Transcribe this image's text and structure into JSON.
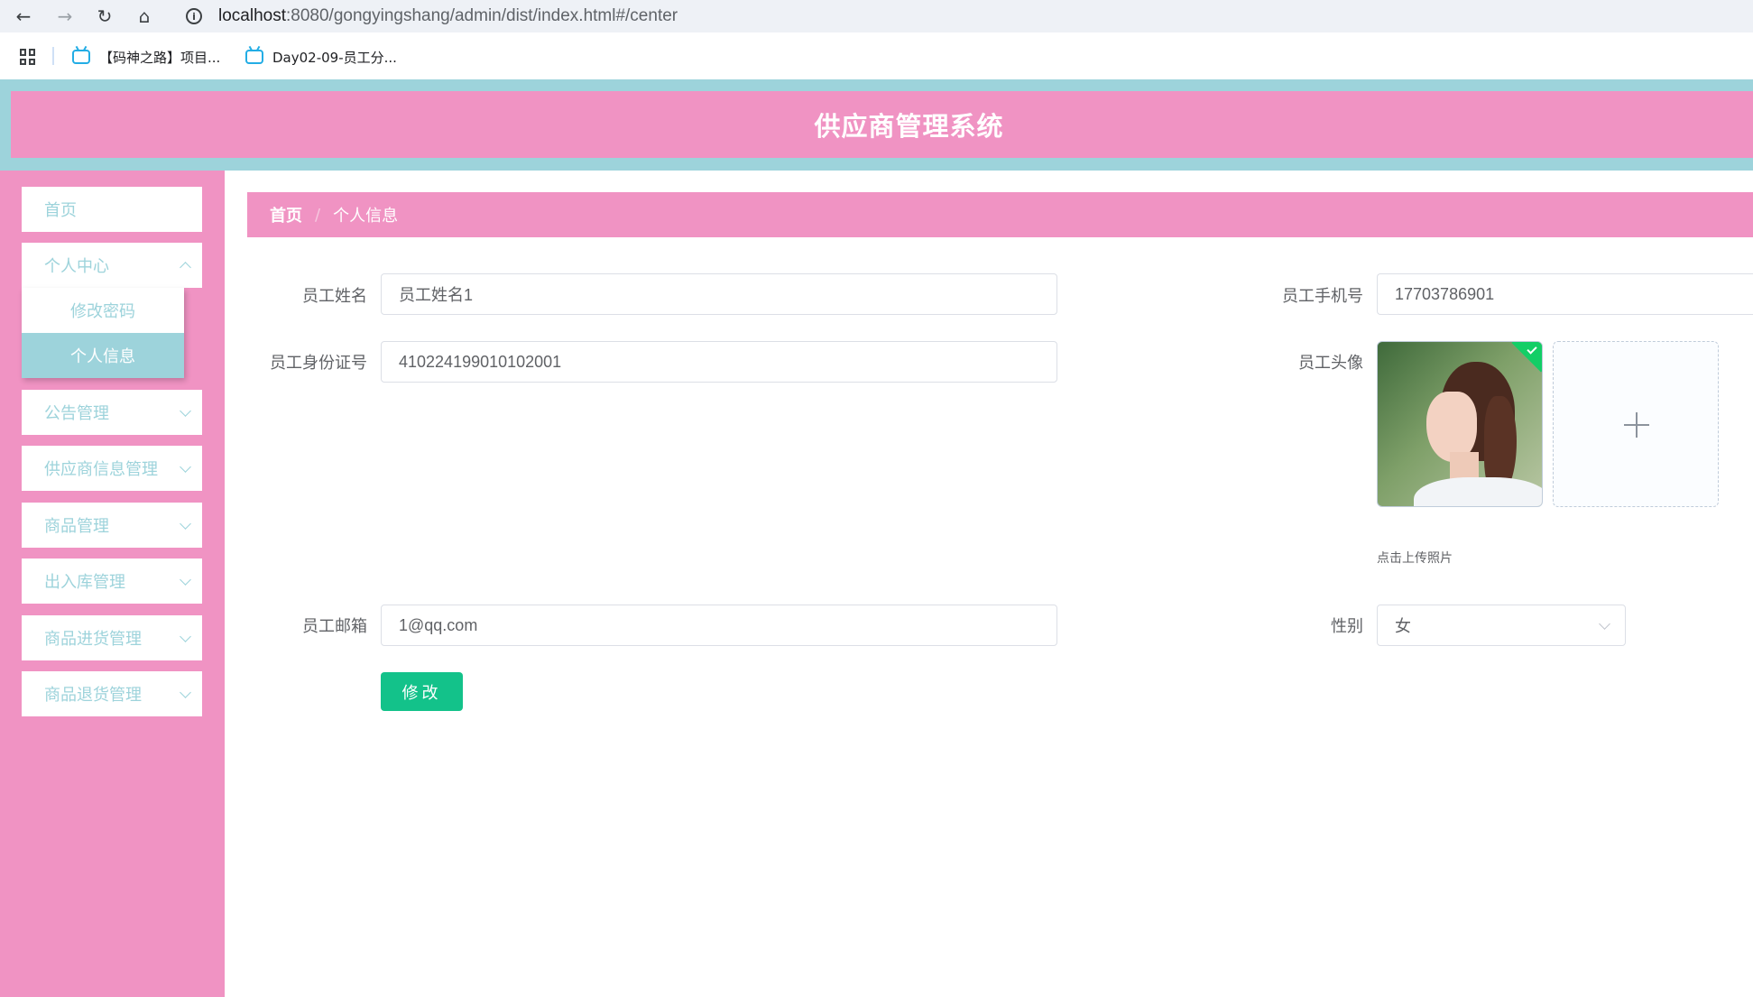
{
  "browser": {
    "url_host": "localhost",
    "url_rest": ":8080/gongyingshang/admin/dist/index.html#/center",
    "bookmarks": [
      {
        "label": "【码神之路】项目..."
      },
      {
        "label": "Day02-09-员工分..."
      }
    ]
  },
  "header": {
    "title": "供应商管理系统"
  },
  "sidebar": {
    "items": [
      {
        "label": "首页"
      },
      {
        "label": "个人中心"
      },
      {
        "label": "公告管理"
      },
      {
        "label": "供应商信息管理"
      },
      {
        "label": "商品管理"
      },
      {
        "label": "出入库管理"
      },
      {
        "label": "商品进货管理"
      },
      {
        "label": "商品退货管理"
      }
    ],
    "submenu": [
      {
        "label": "修改密码"
      },
      {
        "label": "个人信息"
      }
    ]
  },
  "breadcrumb": {
    "home": "首页",
    "separator": "/",
    "current": "个人信息"
  },
  "form": {
    "name_label": "员工姓名",
    "name_value": "员工姓名1",
    "phone_label": "员工手机号",
    "phone_value": "17703786901",
    "idcard_label": "员工身份证号",
    "idcard_value": "410224199010102001",
    "avatar_label": "员工头像",
    "upload_tip": "点击上传照片",
    "email_label": "员工邮箱",
    "email_value": "1@qq.com",
    "gender_label": "性别",
    "gender_value": "女",
    "submit_label": "修改"
  },
  "colors": {
    "primary_pink": "#f093c3",
    "accent_teal": "#9dd3db",
    "button_green": "#13c28a"
  }
}
